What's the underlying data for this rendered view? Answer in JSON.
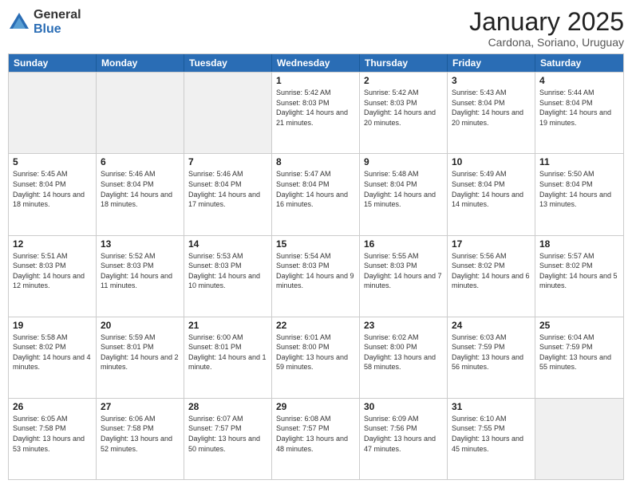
{
  "logo": {
    "general": "General",
    "blue": "Blue"
  },
  "header": {
    "title": "January 2025",
    "location": "Cardona, Soriano, Uruguay"
  },
  "days_of_week": [
    "Sunday",
    "Monday",
    "Tuesday",
    "Wednesday",
    "Thursday",
    "Friday",
    "Saturday"
  ],
  "weeks": [
    [
      {
        "day": "",
        "empty": true
      },
      {
        "day": "",
        "empty": true
      },
      {
        "day": "",
        "empty": true
      },
      {
        "day": "1",
        "rise": "5:42 AM",
        "set": "8:03 PM",
        "daylight": "14 hours and 21 minutes."
      },
      {
        "day": "2",
        "rise": "5:42 AM",
        "set": "8:03 PM",
        "daylight": "14 hours and 20 minutes."
      },
      {
        "day": "3",
        "rise": "5:43 AM",
        "set": "8:04 PM",
        "daylight": "14 hours and 20 minutes."
      },
      {
        "day": "4",
        "rise": "5:44 AM",
        "set": "8:04 PM",
        "daylight": "14 hours and 19 minutes."
      }
    ],
    [
      {
        "day": "5",
        "rise": "5:45 AM",
        "set": "8:04 PM",
        "daylight": "14 hours and 18 minutes."
      },
      {
        "day": "6",
        "rise": "5:46 AM",
        "set": "8:04 PM",
        "daylight": "14 hours and 18 minutes."
      },
      {
        "day": "7",
        "rise": "5:46 AM",
        "set": "8:04 PM",
        "daylight": "14 hours and 17 minutes."
      },
      {
        "day": "8",
        "rise": "5:47 AM",
        "set": "8:04 PM",
        "daylight": "14 hours and 16 minutes."
      },
      {
        "day": "9",
        "rise": "5:48 AM",
        "set": "8:04 PM",
        "daylight": "14 hours and 15 minutes."
      },
      {
        "day": "10",
        "rise": "5:49 AM",
        "set": "8:04 PM",
        "daylight": "14 hours and 14 minutes."
      },
      {
        "day": "11",
        "rise": "5:50 AM",
        "set": "8:04 PM",
        "daylight": "14 hours and 13 minutes."
      }
    ],
    [
      {
        "day": "12",
        "rise": "5:51 AM",
        "set": "8:03 PM",
        "daylight": "14 hours and 12 minutes."
      },
      {
        "day": "13",
        "rise": "5:52 AM",
        "set": "8:03 PM",
        "daylight": "14 hours and 11 minutes."
      },
      {
        "day": "14",
        "rise": "5:53 AM",
        "set": "8:03 PM",
        "daylight": "14 hours and 10 minutes."
      },
      {
        "day": "15",
        "rise": "5:54 AM",
        "set": "8:03 PM",
        "daylight": "14 hours and 9 minutes."
      },
      {
        "day": "16",
        "rise": "5:55 AM",
        "set": "8:03 PM",
        "daylight": "14 hours and 7 minutes."
      },
      {
        "day": "17",
        "rise": "5:56 AM",
        "set": "8:02 PM",
        "daylight": "14 hours and 6 minutes."
      },
      {
        "day": "18",
        "rise": "5:57 AM",
        "set": "8:02 PM",
        "daylight": "14 hours and 5 minutes."
      }
    ],
    [
      {
        "day": "19",
        "rise": "5:58 AM",
        "set": "8:02 PM",
        "daylight": "14 hours and 4 minutes."
      },
      {
        "day": "20",
        "rise": "5:59 AM",
        "set": "8:01 PM",
        "daylight": "14 hours and 2 minutes."
      },
      {
        "day": "21",
        "rise": "6:00 AM",
        "set": "8:01 PM",
        "daylight": "14 hours and 1 minute."
      },
      {
        "day": "22",
        "rise": "6:01 AM",
        "set": "8:00 PM",
        "daylight": "13 hours and 59 minutes."
      },
      {
        "day": "23",
        "rise": "6:02 AM",
        "set": "8:00 PM",
        "daylight": "13 hours and 58 minutes."
      },
      {
        "day": "24",
        "rise": "6:03 AM",
        "set": "7:59 PM",
        "daylight": "13 hours and 56 minutes."
      },
      {
        "day": "25",
        "rise": "6:04 AM",
        "set": "7:59 PM",
        "daylight": "13 hours and 55 minutes."
      }
    ],
    [
      {
        "day": "26",
        "rise": "6:05 AM",
        "set": "7:58 PM",
        "daylight": "13 hours and 53 minutes."
      },
      {
        "day": "27",
        "rise": "6:06 AM",
        "set": "7:58 PM",
        "daylight": "13 hours and 52 minutes."
      },
      {
        "day": "28",
        "rise": "6:07 AM",
        "set": "7:57 PM",
        "daylight": "13 hours and 50 minutes."
      },
      {
        "day": "29",
        "rise": "6:08 AM",
        "set": "7:57 PM",
        "daylight": "13 hours and 48 minutes."
      },
      {
        "day": "30",
        "rise": "6:09 AM",
        "set": "7:56 PM",
        "daylight": "13 hours and 47 minutes."
      },
      {
        "day": "31",
        "rise": "6:10 AM",
        "set": "7:55 PM",
        "daylight": "13 hours and 45 minutes."
      },
      {
        "day": "",
        "empty": true
      }
    ]
  ]
}
